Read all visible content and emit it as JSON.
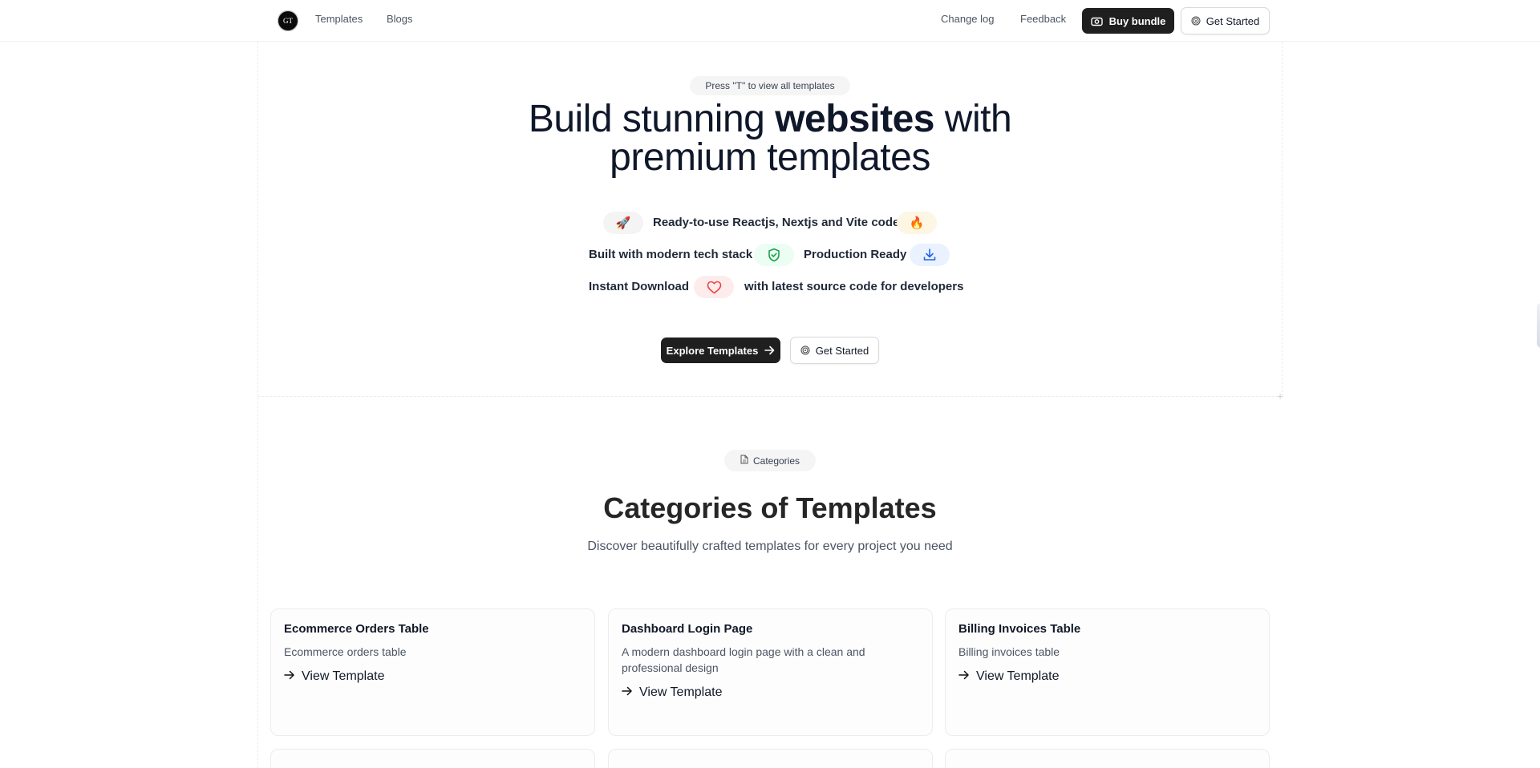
{
  "header": {
    "logo_text": "GT",
    "nav": [
      "Templates",
      "Blogs"
    ],
    "changelog_label": "Change log",
    "feedback_label": "Feedback",
    "buy_label": "Buy bundle",
    "get_started_label": "Get Started"
  },
  "hero": {
    "press_hint": "Press \"T\" to view all templates",
    "title_part1": "Build stunning ",
    "title_bold": "websites",
    "title_part2": " with",
    "title_line2": "premium templates",
    "feature_row1_text": "Ready-to-use Reactjs, Nextjs and Vite code",
    "feature_row2_text_a": "Built with modern tech stack",
    "feature_row2_text_b": "Production Ready",
    "feature_row3_text_a": "Instant Download",
    "feature_row3_text_b": "with latest source code for developers",
    "explore_label": "Explore Templates",
    "get_started_label": "Get Started"
  },
  "categories": {
    "pill_label": "Categories",
    "title": "Categories of Templates",
    "subtitle": "Discover beautifully crafted templates for every project you need",
    "link_label": "View Template",
    "cards": [
      {
        "title": "Ecommerce Orders Table",
        "desc": "Ecommerce orders table"
      },
      {
        "title": "Dashboard Login Page",
        "desc": "A modern dashboard login page with a clean and professional design"
      },
      {
        "title": "Billing Invoices Table",
        "desc": "Billing invoices table"
      }
    ]
  },
  "colors": {
    "primary_dark": "#1f1f1f",
    "badge_rocket_bg": "#f4f4f5",
    "badge_fire_bg": "#fdf6e3",
    "badge_shield_bg": "#ecfdf3",
    "badge_download_bg": "#eaf2ff",
    "badge_heart_bg": "#fdecec"
  }
}
